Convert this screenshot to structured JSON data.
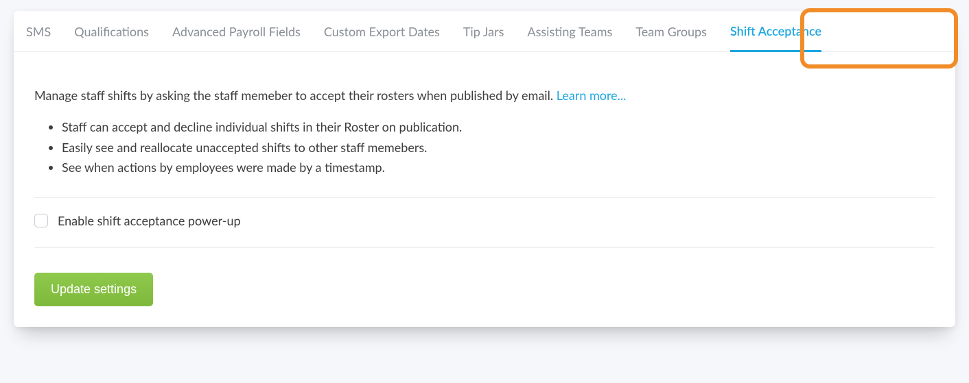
{
  "tabs": {
    "items": [
      {
        "label": "SMS"
      },
      {
        "label": "Qualifications"
      },
      {
        "label": "Advanced Payroll Fields"
      },
      {
        "label": "Custom Export Dates"
      },
      {
        "label": "Tip Jars"
      },
      {
        "label": "Assisting Teams"
      },
      {
        "label": "Team Groups"
      },
      {
        "label": "Shift Acceptance"
      }
    ],
    "activeIndex": 7
  },
  "content": {
    "intro": "Manage staff shifts by asking the staff memeber to accept their rosters when published by email. ",
    "learnMore": "Learn more...",
    "features": [
      "Staff can accept and decline individual shifts in their Roster on publication.",
      "Easily see and reallocate unaccepted shifts to other staff memebers.",
      "See when actions by employees were made by a timestamp."
    ],
    "checkboxLabel": "Enable shift acceptance power-up",
    "updateButton": "Update settings"
  },
  "colors": {
    "accent": "#1ea7e0",
    "highlight": "#f28c28",
    "primaryButton": "#8bc34a"
  }
}
